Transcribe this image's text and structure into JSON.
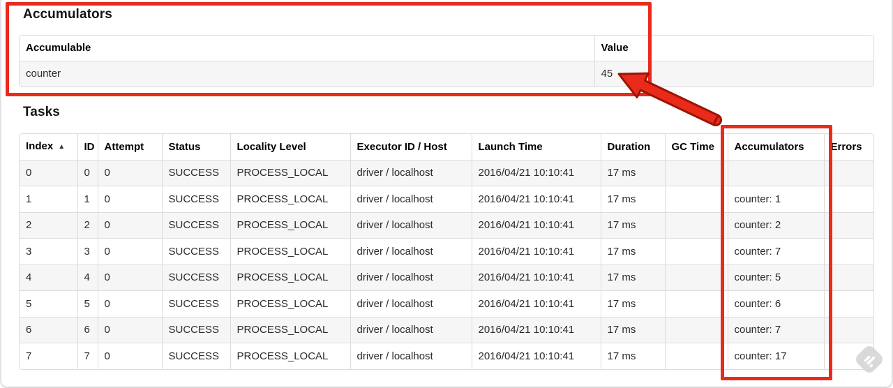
{
  "annotation_color": "#ea2a1a",
  "accumulators": {
    "title": "Accumulators",
    "table": {
      "headers": [
        "Accumulable",
        "Value"
      ],
      "rows": [
        [
          "counter",
          "45"
        ]
      ]
    }
  },
  "tasks": {
    "title": "Tasks",
    "table": {
      "headers": [
        "Index",
        "ID",
        "Attempt",
        "Status",
        "Locality Level",
        "Executor ID / Host",
        "Launch Time",
        "Duration",
        "GC Time",
        "Accumulators",
        "Errors"
      ],
      "sort_icon": "▲",
      "rows": [
        [
          "0",
          "0",
          "0",
          "SUCCESS",
          "PROCESS_LOCAL",
          "driver / localhost",
          "2016/04/21 10:10:41",
          "17 ms",
          "",
          "",
          ""
        ],
        [
          "1",
          "1",
          "0",
          "SUCCESS",
          "PROCESS_LOCAL",
          "driver / localhost",
          "2016/04/21 10:10:41",
          "17 ms",
          "",
          "counter: 1",
          ""
        ],
        [
          "2",
          "2",
          "0",
          "SUCCESS",
          "PROCESS_LOCAL",
          "driver / localhost",
          "2016/04/21 10:10:41",
          "17 ms",
          "",
          "counter: 2",
          ""
        ],
        [
          "3",
          "3",
          "0",
          "SUCCESS",
          "PROCESS_LOCAL",
          "driver / localhost",
          "2016/04/21 10:10:41",
          "17 ms",
          "",
          "counter: 7",
          ""
        ],
        [
          "4",
          "4",
          "0",
          "SUCCESS",
          "PROCESS_LOCAL",
          "driver / localhost",
          "2016/04/21 10:10:41",
          "17 ms",
          "",
          "counter: 5",
          ""
        ],
        [
          "5",
          "5",
          "0",
          "SUCCESS",
          "PROCESS_LOCAL",
          "driver / localhost",
          "2016/04/21 10:10:41",
          "17 ms",
          "",
          "counter: 6",
          ""
        ],
        [
          "6",
          "6",
          "0",
          "SUCCESS",
          "PROCESS_LOCAL",
          "driver / localhost",
          "2016/04/21 10:10:41",
          "17 ms",
          "",
          "counter: 7",
          ""
        ],
        [
          "7",
          "7",
          "0",
          "SUCCESS",
          "PROCESS_LOCAL",
          "driver / localhost",
          "2016/04/21 10:10:41",
          "17 ms",
          "",
          "counter: 17",
          ""
        ]
      ]
    }
  },
  "annotations": {
    "box1_target": "accumulators-section",
    "box2_target": "accumulators-column",
    "arrow_from": "accumulators-column-box",
    "arrow_to": "value-45-cell"
  },
  "watermark": "skitch-pencil-watermark"
}
